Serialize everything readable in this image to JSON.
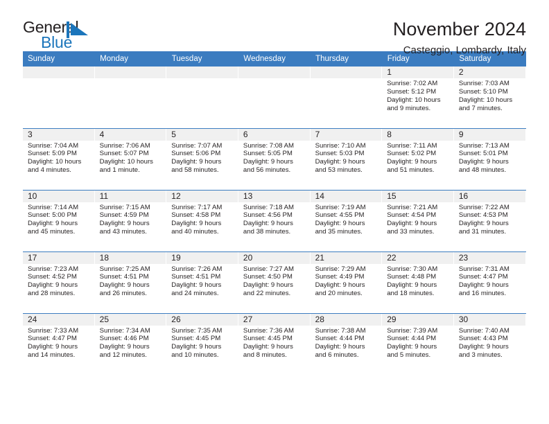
{
  "logo": {
    "word1": "General",
    "word2": "Blue",
    "mark": "triangle-flag-mark",
    "brand_dark": "#231f20",
    "brand_blue": "#1b75bb"
  },
  "header": {
    "title": "November 2024",
    "subtitle": "Casteggio, Lombardy, Italy"
  },
  "theme": {
    "header_blue": "#3b7cc0",
    "day_band_gray": "#f0f0f0",
    "text": "#231f20"
  },
  "weekday_headers": [
    "Sunday",
    "Monday",
    "Tuesday",
    "Wednesday",
    "Thursday",
    "Friday",
    "Saturday"
  ],
  "weeks": [
    [
      {
        "day": "",
        "empty": true,
        "lines": []
      },
      {
        "day": "",
        "empty": true,
        "lines": []
      },
      {
        "day": "",
        "empty": true,
        "lines": []
      },
      {
        "day": "",
        "empty": true,
        "lines": []
      },
      {
        "day": "",
        "empty": true,
        "lines": []
      },
      {
        "day": "1",
        "empty": false,
        "lines": [
          "Sunrise: 7:02 AM",
          "Sunset: 5:12 PM",
          "Daylight: 10 hours",
          "and 9 minutes."
        ]
      },
      {
        "day": "2",
        "empty": false,
        "lines": [
          "Sunrise: 7:03 AM",
          "Sunset: 5:10 PM",
          "Daylight: 10 hours",
          "and 7 minutes."
        ]
      }
    ],
    [
      {
        "day": "3",
        "empty": false,
        "lines": [
          "Sunrise: 7:04 AM",
          "Sunset: 5:09 PM",
          "Daylight: 10 hours",
          "and 4 minutes."
        ]
      },
      {
        "day": "4",
        "empty": false,
        "lines": [
          "Sunrise: 7:06 AM",
          "Sunset: 5:07 PM",
          "Daylight: 10 hours",
          "and 1 minute."
        ]
      },
      {
        "day": "5",
        "empty": false,
        "lines": [
          "Sunrise: 7:07 AM",
          "Sunset: 5:06 PM",
          "Daylight: 9 hours",
          "and 58 minutes."
        ]
      },
      {
        "day": "6",
        "empty": false,
        "lines": [
          "Sunrise: 7:08 AM",
          "Sunset: 5:05 PM",
          "Daylight: 9 hours",
          "and 56 minutes."
        ]
      },
      {
        "day": "7",
        "empty": false,
        "lines": [
          "Sunrise: 7:10 AM",
          "Sunset: 5:03 PM",
          "Daylight: 9 hours",
          "and 53 minutes."
        ]
      },
      {
        "day": "8",
        "empty": false,
        "lines": [
          "Sunrise: 7:11 AM",
          "Sunset: 5:02 PM",
          "Daylight: 9 hours",
          "and 51 minutes."
        ]
      },
      {
        "day": "9",
        "empty": false,
        "lines": [
          "Sunrise: 7:13 AM",
          "Sunset: 5:01 PM",
          "Daylight: 9 hours",
          "and 48 minutes."
        ]
      }
    ],
    [
      {
        "day": "10",
        "empty": false,
        "lines": [
          "Sunrise: 7:14 AM",
          "Sunset: 5:00 PM",
          "Daylight: 9 hours",
          "and 45 minutes."
        ]
      },
      {
        "day": "11",
        "empty": false,
        "lines": [
          "Sunrise: 7:15 AM",
          "Sunset: 4:59 PM",
          "Daylight: 9 hours",
          "and 43 minutes."
        ]
      },
      {
        "day": "12",
        "empty": false,
        "lines": [
          "Sunrise: 7:17 AM",
          "Sunset: 4:58 PM",
          "Daylight: 9 hours",
          "and 40 minutes."
        ]
      },
      {
        "day": "13",
        "empty": false,
        "lines": [
          "Sunrise: 7:18 AM",
          "Sunset: 4:56 PM",
          "Daylight: 9 hours",
          "and 38 minutes."
        ]
      },
      {
        "day": "14",
        "empty": false,
        "lines": [
          "Sunrise: 7:19 AM",
          "Sunset: 4:55 PM",
          "Daylight: 9 hours",
          "and 35 minutes."
        ]
      },
      {
        "day": "15",
        "empty": false,
        "lines": [
          "Sunrise: 7:21 AM",
          "Sunset: 4:54 PM",
          "Daylight: 9 hours",
          "and 33 minutes."
        ]
      },
      {
        "day": "16",
        "empty": false,
        "lines": [
          "Sunrise: 7:22 AM",
          "Sunset: 4:53 PM",
          "Daylight: 9 hours",
          "and 31 minutes."
        ]
      }
    ],
    [
      {
        "day": "17",
        "empty": false,
        "lines": [
          "Sunrise: 7:23 AM",
          "Sunset: 4:52 PM",
          "Daylight: 9 hours",
          "and 28 minutes."
        ]
      },
      {
        "day": "18",
        "empty": false,
        "lines": [
          "Sunrise: 7:25 AM",
          "Sunset: 4:51 PM",
          "Daylight: 9 hours",
          "and 26 minutes."
        ]
      },
      {
        "day": "19",
        "empty": false,
        "lines": [
          "Sunrise: 7:26 AM",
          "Sunset: 4:51 PM",
          "Daylight: 9 hours",
          "and 24 minutes."
        ]
      },
      {
        "day": "20",
        "empty": false,
        "lines": [
          "Sunrise: 7:27 AM",
          "Sunset: 4:50 PM",
          "Daylight: 9 hours",
          "and 22 minutes."
        ]
      },
      {
        "day": "21",
        "empty": false,
        "lines": [
          "Sunrise: 7:29 AM",
          "Sunset: 4:49 PM",
          "Daylight: 9 hours",
          "and 20 minutes."
        ]
      },
      {
        "day": "22",
        "empty": false,
        "lines": [
          "Sunrise: 7:30 AM",
          "Sunset: 4:48 PM",
          "Daylight: 9 hours",
          "and 18 minutes."
        ]
      },
      {
        "day": "23",
        "empty": false,
        "lines": [
          "Sunrise: 7:31 AM",
          "Sunset: 4:47 PM",
          "Daylight: 9 hours",
          "and 16 minutes."
        ]
      }
    ],
    [
      {
        "day": "24",
        "empty": false,
        "lines": [
          "Sunrise: 7:33 AM",
          "Sunset: 4:47 PM",
          "Daylight: 9 hours",
          "and 14 minutes."
        ]
      },
      {
        "day": "25",
        "empty": false,
        "lines": [
          "Sunrise: 7:34 AM",
          "Sunset: 4:46 PM",
          "Daylight: 9 hours",
          "and 12 minutes."
        ]
      },
      {
        "day": "26",
        "empty": false,
        "lines": [
          "Sunrise: 7:35 AM",
          "Sunset: 4:45 PM",
          "Daylight: 9 hours",
          "and 10 minutes."
        ]
      },
      {
        "day": "27",
        "empty": false,
        "lines": [
          "Sunrise: 7:36 AM",
          "Sunset: 4:45 PM",
          "Daylight: 9 hours",
          "and 8 minutes."
        ]
      },
      {
        "day": "28",
        "empty": false,
        "lines": [
          "Sunrise: 7:38 AM",
          "Sunset: 4:44 PM",
          "Daylight: 9 hours",
          "and 6 minutes."
        ]
      },
      {
        "day": "29",
        "empty": false,
        "lines": [
          "Sunrise: 7:39 AM",
          "Sunset: 4:44 PM",
          "Daylight: 9 hours",
          "and 5 minutes."
        ]
      },
      {
        "day": "30",
        "empty": false,
        "lines": [
          "Sunrise: 7:40 AM",
          "Sunset: 4:43 PM",
          "Daylight: 9 hours",
          "and 3 minutes."
        ]
      }
    ]
  ]
}
